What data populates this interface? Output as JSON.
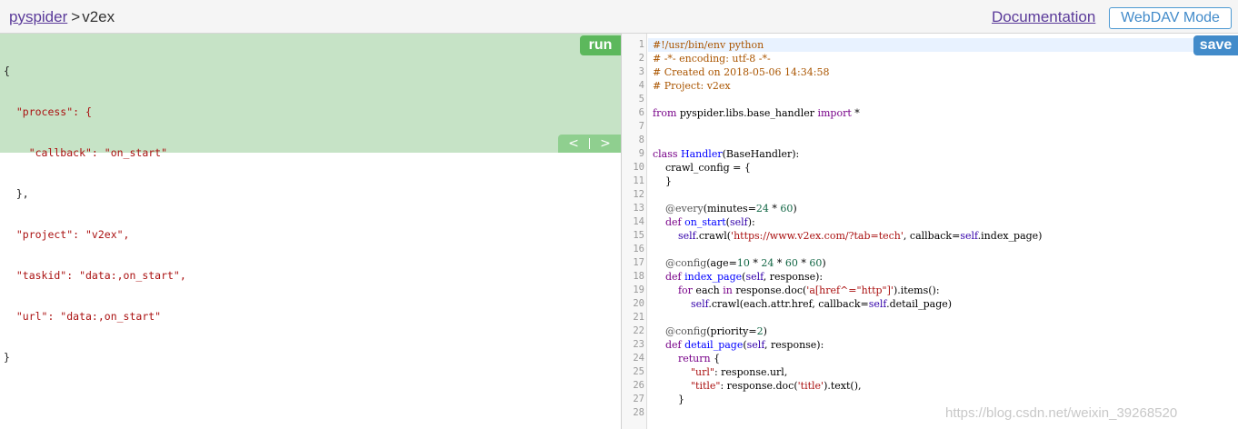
{
  "header": {
    "breadcrumb_root": "pyspider",
    "breadcrumb_separator": ">",
    "breadcrumb_current": "v2ex",
    "documentation_label": "Documentation",
    "webdav_label": "WebDAV Mode"
  },
  "task_panel": {
    "run_label": "run",
    "prev_label": "<",
    "divider_label": "|",
    "next_label": ">",
    "json_lines": [
      "{",
      "  \"process\": {",
      "    \"callback\": \"on_start\"",
      "  },",
      "  \"project\": \"v2ex\",",
      "  \"taskid\": \"data:,on_start\",",
      "  \"url\": \"data:,on_start\"",
      "}"
    ]
  },
  "editor": {
    "save_label": "save",
    "line_numbers": [
      "1",
      "2",
      "3",
      "4",
      "5",
      "6",
      "7",
      "8",
      "9",
      "10",
      "11",
      "12",
      "13",
      "14",
      "15",
      "16",
      "17",
      "18",
      "19",
      "20",
      "21",
      "22",
      "23",
      "24",
      "25",
      "26",
      "27",
      "28"
    ],
    "code_lines": [
      "#!/usr/bin/env python",
      "# -*- encoding: utf-8 -*-",
      "# Created on 2018-05-06 14:34:58",
      "# Project: v2ex",
      "",
      "from pyspider.libs.base_handler import *",
      "",
      "",
      "class Handler(BaseHandler):",
      "    crawl_config = {",
      "    }",
      "",
      "    @every(minutes=24 * 60)",
      "    def on_start(self):",
      "        self.crawl('https://www.v2ex.com/?tab=tech', callback=self.index_page)",
      "",
      "    @config(age=10 * 24 * 60 * 60)",
      "    def index_page(self, response):",
      "        for each in response.doc('a[href^=\"http\"]').items():",
      "            self.crawl(each.attr.href, callback=self.detail_page)",
      "",
      "    @config(priority=2)",
      "    def detail_page(self, response):",
      "        return {",
      "            \"url\": response.url,",
      "            \"title\": response.doc('title').text(),",
      "        }",
      ""
    ]
  },
  "watermark": "https://blog.csdn.net/weixin_39268520",
  "colors": {
    "task_panel_bg": "#c6e3c6",
    "run_button": "#5cb85c",
    "save_button": "#428bca",
    "link": "#5b3b9a"
  }
}
